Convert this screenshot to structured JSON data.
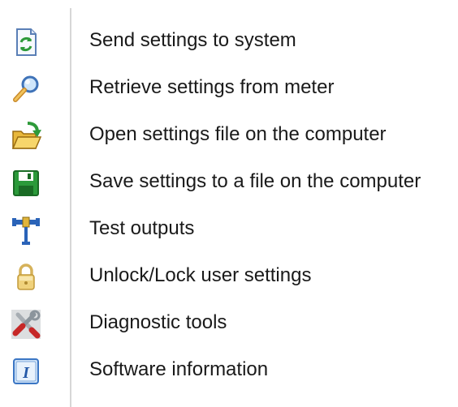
{
  "toolbar": {
    "items": [
      {
        "icon": "send-settings-icon",
        "label": "Send settings to system"
      },
      {
        "icon": "magnifier-icon",
        "label": "Retrieve settings from meter"
      },
      {
        "icon": "open-folder-icon",
        "label": "Open settings file on the computer"
      },
      {
        "icon": "save-disk-icon",
        "label": "Save settings to a file on the computer"
      },
      {
        "icon": "test-outputs-icon",
        "label": "Test outputs"
      },
      {
        "icon": "lock-icon",
        "label": "Unlock/Lock user settings"
      },
      {
        "icon": "diagnostic-tools-icon",
        "label": "Diagnostic tools"
      },
      {
        "icon": "info-icon",
        "label": "Software information"
      }
    ]
  }
}
